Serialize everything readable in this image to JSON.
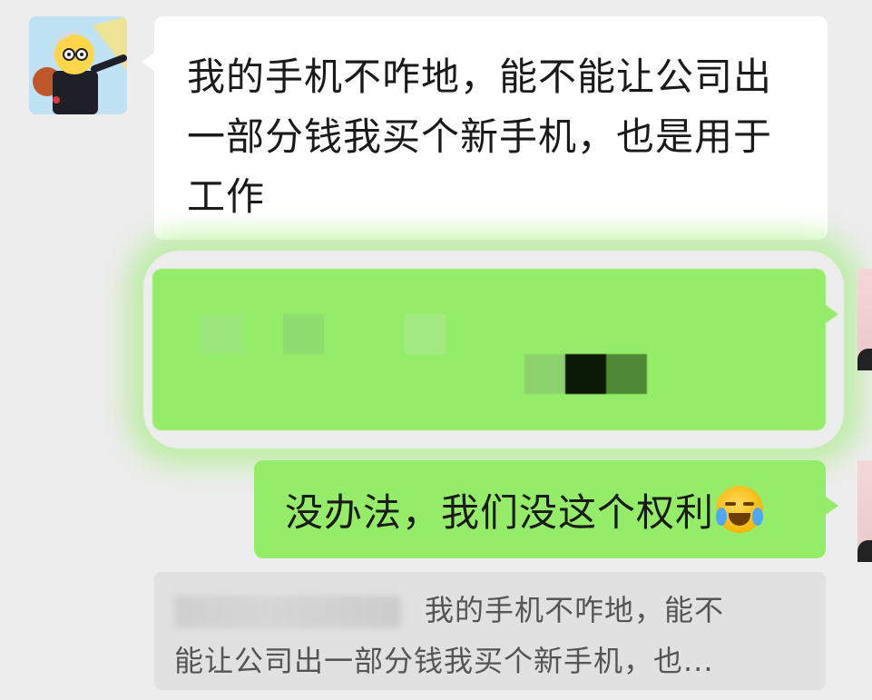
{
  "chat": {
    "messages": [
      {
        "side": "incoming",
        "lines": [
          "我的手机不咋地，能不能让公司出",
          "一部分钱我买个新手机，也是用于",
          "工作"
        ]
      },
      {
        "side": "outgoing",
        "redacted": true,
        "pixel_colors": [
          "#9be67a",
          "#8fdc6f",
          "#a4ea84",
          "#8cd26c",
          "#0b1a06",
          "#4e8a35"
        ]
      },
      {
        "side": "outgoing",
        "text": "没办法，我们没这个权利",
        "emoji": "face-with-tears-of-joy-emoji"
      }
    ],
    "quote": {
      "text_line1": "我的手机不咋地，能不",
      "text_line2": "能让公司出一部分钱我买个新手机，也..."
    }
  },
  "colors": {
    "background": "#ededed",
    "incoming_bubble": "#ffffff",
    "outgoing_bubble": "#95ec69",
    "quote_background": "#e1e1e1"
  }
}
